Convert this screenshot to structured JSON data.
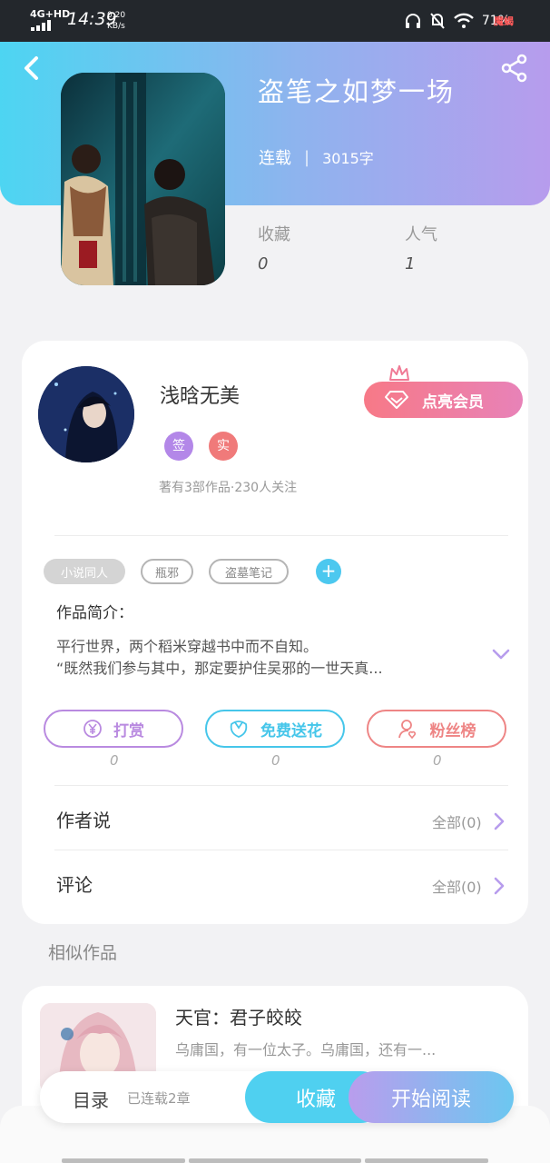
{
  "status_bar": {
    "network": "4G+HD",
    "time": "14:39",
    "speed_value": "0.20",
    "speed_unit": "KB/s",
    "battery": "71%",
    "logo_text": "魔蝎"
  },
  "book": {
    "title": "盗笔之如梦一场",
    "status": "连载",
    "separator": "|",
    "word_count": "3015字",
    "stats": [
      {
        "label": "收藏",
        "value": "0"
      },
      {
        "label": "人气",
        "value": "1"
      }
    ]
  },
  "author": {
    "name": "浅晗无美",
    "badges": [
      {
        "text": "签",
        "color": "#b387e8"
      },
      {
        "text": "实",
        "color": "#f07a7a"
      }
    ],
    "stats_text": "著有3部作品·230人关注",
    "vip_button": "点亮会员"
  },
  "tags": [
    "小说同人",
    "瓶邪",
    "盗墓笔记"
  ],
  "intro": {
    "title": "作品简介：",
    "line1": "平行世界，两个稻米穿越书中而不自知。",
    "line2": "“既然我们参与其中，那定要护住吴邪的一世天真..."
  },
  "actions": [
    {
      "label": "打赏",
      "count": "0",
      "color": "#b98ae0",
      "icon": "yen-icon"
    },
    {
      "label": "免费送花",
      "count": "0",
      "color": "#46c6ea",
      "icon": "flower-icon"
    },
    {
      "label": "粉丝榜",
      "count": "0",
      "color": "#ee8585",
      "icon": "fan-icon"
    }
  ],
  "rows": [
    {
      "title": "作者说",
      "right": "全部(0)"
    },
    {
      "title": "评论",
      "right": "全部(0)"
    }
  ],
  "similar": {
    "label": "相似作品",
    "items": [
      {
        "title": "天官：君子皎皎",
        "desc": "乌庸国，有一位太子。乌庸国，还有一..."
      }
    ]
  },
  "bottom_bar": {
    "toc": "目录",
    "toc_status": "已连载2章",
    "collect": "收藏",
    "read": "开始阅读"
  }
}
